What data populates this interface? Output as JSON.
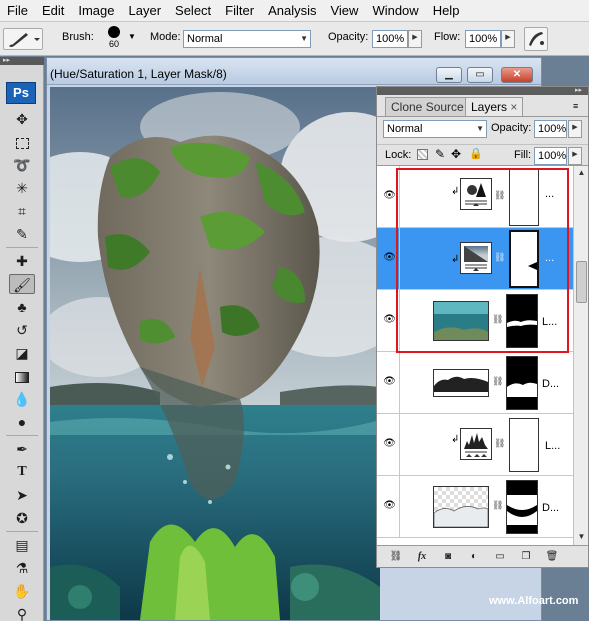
{
  "menu": [
    "File",
    "Edit",
    "Image",
    "Layer",
    "Select",
    "Filter",
    "Analysis",
    "View",
    "Window",
    "Help"
  ],
  "options": {
    "brush_label": "Brush:",
    "brush_size": "60",
    "mode_label": "Mode:",
    "mode_value": "Normal",
    "opacity_label": "Opacity:",
    "opacity_value": "100%",
    "flow_label": "Flow:",
    "flow_value": "100%"
  },
  "toolbox": {
    "logo": "Ps",
    "tools": [
      "move-tool",
      "marquee-tool",
      "lasso-tool",
      "magic-wand-tool",
      "crop-tool",
      "eyedropper-tool",
      "healing-brush-tool",
      "brush-tool",
      "clone-stamp-tool",
      "history-brush-tool",
      "eraser-tool",
      "gradient-tool",
      "blur-tool",
      "dodge-tool",
      "pen-tool",
      "type-tool",
      "path-selection-tool",
      "shape-tool",
      "notes-tool",
      "eyedropper-tool-2",
      "hand-tool",
      "zoom-tool"
    ],
    "active_tool": "brush-tool"
  },
  "document": {
    "title": "(Hue/Saturation 1, Layer Mask/8)"
  },
  "panel": {
    "tabs": [
      "Clone Source",
      "Layers"
    ],
    "active_tab": "Layers",
    "tab_close": "×",
    "blend_mode": "Normal",
    "opacity_label": "Opacity:",
    "opacity_value": "100%",
    "lock_label": "Lock:",
    "fill_label": "Fill:",
    "fill_value": "100%",
    "layers": [
      {
        "name": "...",
        "type": "levels-adjustment",
        "clipped": true,
        "selected": false
      },
      {
        "name": "...",
        "type": "hue-saturation-adjustment",
        "clipped": true,
        "selected": true
      },
      {
        "name": "L...",
        "type": "image",
        "clipped": false,
        "selected": false
      },
      {
        "name": "D...",
        "type": "image",
        "clipped": false,
        "selected": false
      },
      {
        "name": "L...",
        "type": "levels-adjustment",
        "clipped": true,
        "selected": false
      },
      {
        "name": "D...",
        "type": "image",
        "clipped": false,
        "selected": false
      }
    ],
    "footer_buttons": [
      "link-layers",
      "layer-style",
      "add-mask",
      "new-adjustment",
      "new-group",
      "new-layer",
      "delete-layer"
    ],
    "footer_fx": "fx"
  },
  "watermark": "www.Alfoart.com",
  "colors": {
    "selection": "#3b96f2",
    "highlight_box": "#e0161f",
    "ps_logo": "#1b63b6"
  }
}
